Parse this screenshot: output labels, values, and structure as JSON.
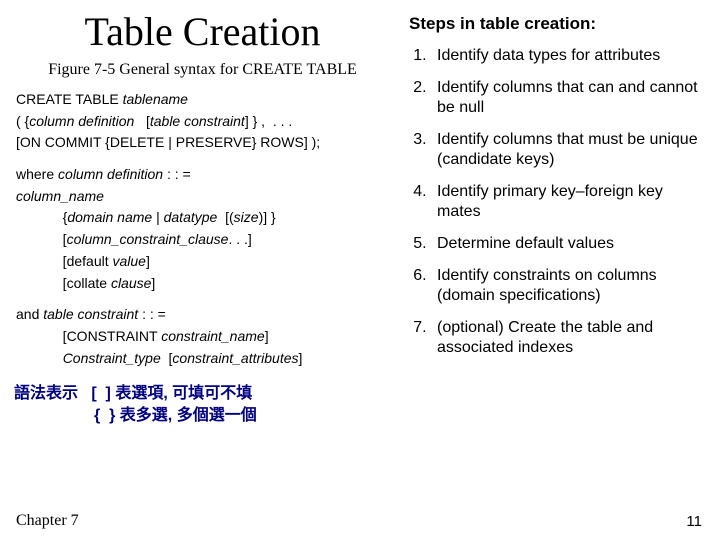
{
  "title": "Table Creation",
  "figure_caption": "Figure 7-5 General syntax for CREATE TABLE",
  "syntax": {
    "l1a": "CREATE TABLE ",
    "l1b": "tablename",
    "l2a": "( {",
    "l2b": "column definition",
    "l2c": "   [",
    "l2d": "table constraint",
    "l2e": "] } ,  . . .",
    "l3": "[ON COMMIT {DELETE | PRESERVE} ROWS] );",
    "l4a": "where ",
    "l4b": "column definition",
    "l4c": " : : =",
    "l5": "column_name",
    "l6a": "            {",
    "l6b": "domain name",
    "l6c": " | ",
    "l6d": "datatype",
    "l6e": "  [(",
    "l6f": "size",
    "l6g": ")] }",
    "l7a": "            [",
    "l7b": "column_constraint_clause",
    "l7c": ". . .]",
    "l8a": "            [default ",
    "l8b": "value",
    "l8c": "]",
    "l9a": "            [collate ",
    "l9b": "clause",
    "l9c": "]",
    "l10a": "and ",
    "l10b": "table constraint",
    "l10c": " : : =",
    "l11a": "            [CONSTRAINT ",
    "l11b": "constraint_name",
    "l11c": "]",
    "l12a": "            ",
    "l12b": "Constraint_type",
    "l12c": "  [",
    "l12d": "constraint_attributes",
    "l12e": "]"
  },
  "chinese_line1": "語法表示   [  ] 表選項, 可填可不填",
  "chinese_line2": "                  {  } 表多選, 多個選一個",
  "chapter": "Chapter 7",
  "pagenum": "11",
  "steps_heading": "Steps in table creation:",
  "steps": [
    "Identify data types for attributes",
    "Identify columns that can and cannot be null",
    "Identify columns that must be unique (candidate keys)",
    "Identify primary key–foreign key mates",
    "Determine default values",
    "Identify constraints on columns (domain specifications)",
    "(optional) Create the table and associated indexes"
  ]
}
